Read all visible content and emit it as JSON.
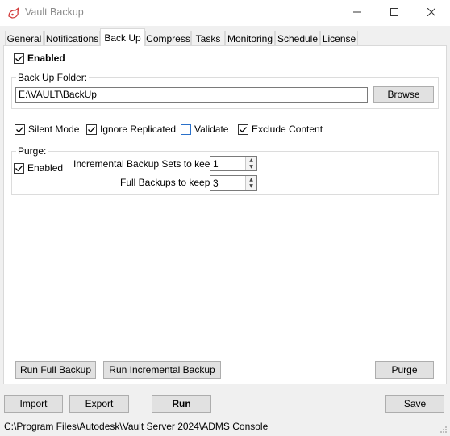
{
  "window": {
    "title": "Vault Backup",
    "controls": [
      "minimize-icon",
      "maximize-icon",
      "close-icon"
    ]
  },
  "tabs": [
    {
      "label": "General"
    },
    {
      "label": "Notifications"
    },
    {
      "label": "Back Up",
      "active": true
    },
    {
      "label": "Compress"
    },
    {
      "label": "Tasks"
    },
    {
      "label": "Monitoring"
    },
    {
      "label": "Schedule"
    },
    {
      "label": "License"
    }
  ],
  "backup": {
    "enabled_label": "Enabled",
    "enabled_checked": true,
    "folder_group_label": "Back Up Folder:",
    "folder_value": "E:\\VAULT\\BackUp",
    "browse_label": "Browse",
    "options": [
      {
        "label": "Silent Mode",
        "checked": true
      },
      {
        "label": "Ignore Replicated",
        "checked": true
      },
      {
        "label": "Validate",
        "checked": false
      },
      {
        "label": "Exclude Content",
        "checked": true
      }
    ],
    "purge": {
      "group_label": "Purge:",
      "enabled_label": "Enabled",
      "enabled_checked": true,
      "incremental_label": "Incremental Backup Sets to keep:",
      "incremental_value": "1",
      "full_label": "Full Backups to keep:",
      "full_value": "3"
    },
    "run_full_label": "Run Full Backup",
    "run_incremental_label": "Run Incremental Backup",
    "purge_button_label": "Purge"
  },
  "footer": {
    "import_label": "Import",
    "export_label": "Export",
    "run_label": "Run",
    "save_label": "Save"
  },
  "status": {
    "path": "C:\\Program Files\\Autodesk\\Vault Server 2024\\ADMS Console"
  },
  "colors": {
    "accent": "#2a70c9",
    "icon_red": "#d23b3b"
  }
}
